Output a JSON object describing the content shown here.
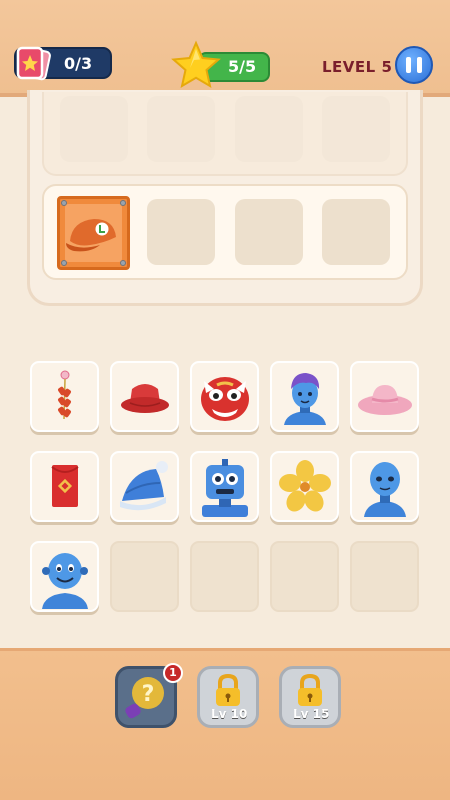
{
  "header": {
    "cards_progress": "0/3",
    "stars_progress": "5/5",
    "level_label": "LEVEL 5"
  },
  "board": {
    "target_item": "orange-cap-icon"
  },
  "grid": {
    "tiles": [
      {
        "item": "firecracker-icon"
      },
      {
        "item": "red-bucket-hat-icon"
      },
      {
        "item": "lion-dance-mask-icon"
      },
      {
        "item": "purple-hair-robot-icon"
      },
      {
        "item": "pink-hat-icon"
      },
      {
        "item": "red-envelope-icon"
      },
      {
        "item": "blue-beanie-icon"
      },
      {
        "item": "square-robot-icon"
      },
      {
        "item": "yellow-flower-icon"
      },
      {
        "item": "blue-robot-icon"
      },
      {
        "item": "blue-robot-smile-icon"
      },
      {
        "item": ""
      },
      {
        "item": ""
      },
      {
        "item": ""
      },
      {
        "item": ""
      }
    ]
  },
  "boosters": {
    "hint_count": "1",
    "lock1_label": "Lv 10",
    "lock2_label": "Lv 15"
  },
  "colors": {
    "topbar": "#f3c79b",
    "background": "#f6ebdc",
    "accent_green": "#43b54a",
    "accent_blue": "#2b6fd6",
    "level_text": "#7a1f2c"
  }
}
